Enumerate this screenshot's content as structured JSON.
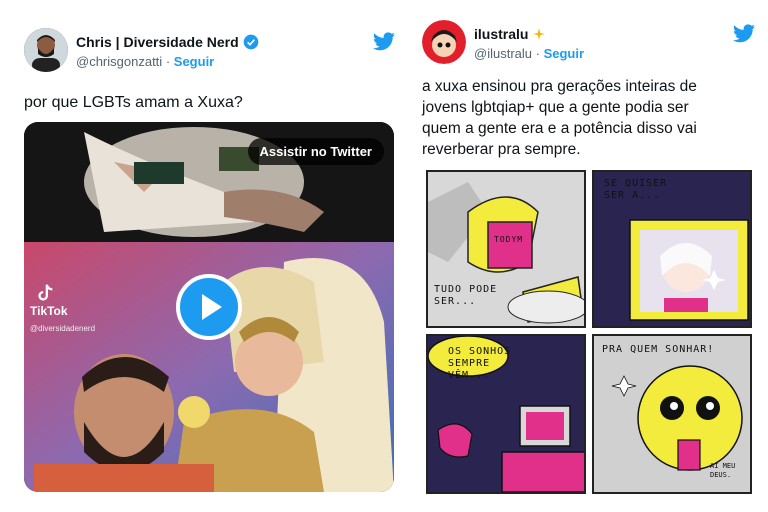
{
  "left_tweet": {
    "author_name": "Chris | Diversidade Nerd",
    "handle": "@chrisgonzatti",
    "separator": "·",
    "follow_label": "Seguir",
    "text": "por que LGBTs amam a Xuxa?",
    "media": {
      "watch_label": "Assistir no Twitter",
      "tiktok_label": "TikTok",
      "tiktok_user": "@diversidadenerd"
    },
    "icons": {
      "verified": "verified-badge-icon",
      "bird": "twitter-bird-icon",
      "play": "play-icon"
    }
  },
  "right_tweet": {
    "author_name": "ilustralu",
    "handle": "@ilustralu",
    "separator": "·",
    "follow_label": "Seguir",
    "text_lines": [
      "a xuxa ensinou pra gerações inteiras de",
      "jovens lgbtqiap+ que a gente podia ser",
      "quem a gente era e a potência disso vai",
      "reverberar pra sempre."
    ],
    "comic": {
      "panel1_text": [
        "TUDO PODE",
        "SER..."
      ],
      "panel1_label": "TODYM",
      "panel2_text": [
        "SE QUISER",
        "SER A..."
      ],
      "panel3_text": [
        "OS SONHOS",
        "SEMPRE",
        "VÊM..."
      ],
      "panel4_text": [
        "PRA QUEM SONHAR!"
      ],
      "panel4_small": [
        "AI MEU",
        "DEUS."
      ]
    },
    "icons": {
      "sparkle": "sparkle-icon",
      "bird": "twitter-bird-icon"
    }
  },
  "colors": {
    "twitter_blue": "#1d9bf0",
    "comic_yellow": "#f3ec3c",
    "comic_pink": "#e0308a",
    "comic_navy": "#2a2450"
  }
}
